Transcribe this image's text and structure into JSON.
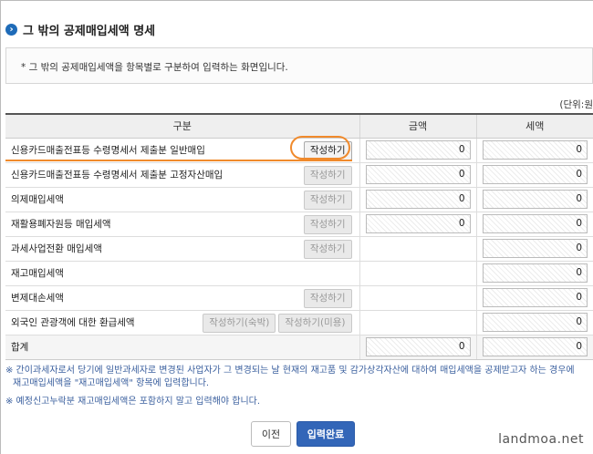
{
  "header": {
    "title": "그 밖의 공제매입세액 명세",
    "icon": "circle-arrow-icon"
  },
  "info": {
    "text": "* 그 밖의 공제매입세액을 항목별로 구분하여 입력하는 화면입니다."
  },
  "unit_label": "(단위:원",
  "table": {
    "columns": [
      "구분",
      "금액",
      "세액"
    ],
    "rows": [
      {
        "label": "신용카드매출전표등 수령명세서 제출분 일반매입",
        "buttons": [
          "작성하기"
        ],
        "amount": "0",
        "tax": "0"
      },
      {
        "label": "신용카드매출전표등 수령명세서 제출분 고정자산매입",
        "buttons": [
          "작성하기"
        ],
        "amount": "0",
        "tax": "0"
      },
      {
        "label": "의제매입세액",
        "buttons": [
          "작성하기"
        ],
        "amount": "0",
        "tax": "0"
      },
      {
        "label": "재활용폐자원등 매입세액",
        "buttons": [
          "작성하기"
        ],
        "amount": "0",
        "tax": "0"
      },
      {
        "label": "과세사업전환 매입세액",
        "buttons": [
          "작성하기"
        ],
        "amount": null,
        "tax": "0"
      },
      {
        "label": "재고매입세액",
        "buttons": [],
        "amount": null,
        "tax": "0"
      },
      {
        "label": "변제대손세액",
        "buttons": [
          "작성하기"
        ],
        "amount": null,
        "tax": "0"
      },
      {
        "label": "외국인 관광객에 대한 환급세액",
        "buttons": [
          "작성하기(숙박)",
          "작성하기(미용)"
        ],
        "amount": null,
        "tax": "0"
      },
      {
        "label": "합계",
        "buttons": [],
        "amount": "0",
        "tax": "0"
      }
    ]
  },
  "notes": [
    "※ 간이과세자로서 당기에 일반과세자로 변경된 사업자가 그 변경되는 날 현재의 재고품 및 감가상각자산에 대하여 매입세액을 공제받고자 하는 경우에",
    "재고매입세액을 \"재고매입세액\" 항목에 입력합니다.",
    "※ 예정신고누락분 재고매입세액은 포함하지 말고 입력해야 합니다."
  ],
  "footer": {
    "prev_label": "이전",
    "done_label": "입력완료"
  },
  "watermark": "landmoa.net",
  "colors": {
    "accent": "#3366b8",
    "highlight": "#f08a2c",
    "note": "#3a5f9e"
  }
}
